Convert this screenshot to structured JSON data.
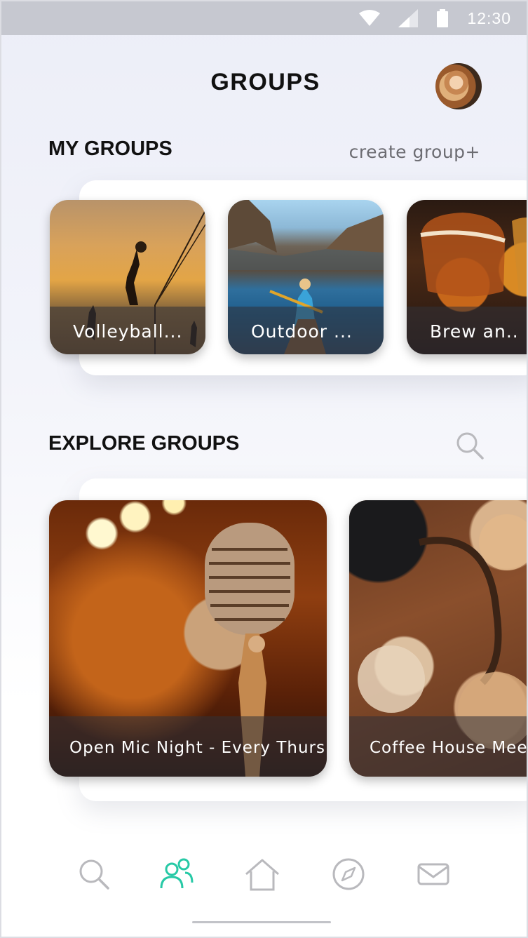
{
  "status_bar": {
    "time": "12:30"
  },
  "header": {
    "title": "GROUPS"
  },
  "my_groups": {
    "title": "MY GROUPS",
    "create_label": "create group+",
    "groups": [
      {
        "label": "Volleyball..."
      },
      {
        "label": "Outdoor ..."
      },
      {
        "label": "Brew an.."
      }
    ]
  },
  "explore_groups": {
    "title": "EXPLORE GROUPS",
    "groups": [
      {
        "label": "Open Mic Night - Every Thurs."
      },
      {
        "label": "Coffee House Mee"
      }
    ]
  },
  "bottom_nav": {
    "items": [
      "search-icon",
      "groups-icon",
      "home-icon",
      "compass-icon",
      "mail-icon"
    ],
    "active": "groups-icon"
  },
  "colors": {
    "accent": "#27c9a6",
    "icon_gray": "#b9b9bd",
    "status_bar": "#c6c8d0"
  }
}
